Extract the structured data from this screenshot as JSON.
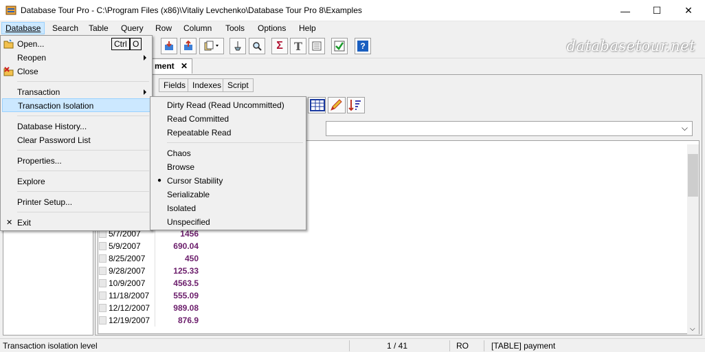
{
  "window": {
    "title": "Database Tour Pro - C:\\Program Files (x86)\\Vitaliy Levchenko\\Database Tour Pro 8\\Examples",
    "minimize": "—",
    "maximize": "☐",
    "close": "✕"
  },
  "menubar": [
    {
      "label": "Database"
    },
    {
      "label": "Search"
    },
    {
      "label": "Table"
    },
    {
      "label": "Query"
    },
    {
      "label": "Row"
    },
    {
      "label": "Column"
    },
    {
      "label": "Tools"
    },
    {
      "label": "Options"
    },
    {
      "label": "Help"
    }
  ],
  "watermark": "databasetour.net",
  "doc_tab": {
    "label": "ment",
    "close": "✕"
  },
  "subtabs": [
    "Fields",
    "Indexes",
    "Script"
  ],
  "database_menu": {
    "items": [
      {
        "label": "Open...",
        "shortcut_ctrl": "Ctrl",
        "shortcut_key": "O"
      },
      {
        "label": "Reopen"
      },
      {
        "label": "Close"
      },
      {
        "label": "Transaction"
      },
      {
        "label": "Transaction Isolation"
      },
      {
        "label": "Database History..."
      },
      {
        "label": "Clear Password List"
      },
      {
        "label": "Properties..."
      },
      {
        "label": "Explore"
      },
      {
        "label": "Printer Setup..."
      },
      {
        "label": "Exit"
      }
    ]
  },
  "isolation_menu": {
    "items": [
      {
        "label": "Dirty Read (Read Uncommitted)"
      },
      {
        "label": "Read Committed"
      },
      {
        "label": "Repeatable Read"
      },
      {
        "label": "Chaos"
      },
      {
        "label": "Browse"
      },
      {
        "label": "Cursor Stability",
        "checked": true
      },
      {
        "label": "Serializable"
      },
      {
        "label": "Isolated"
      },
      {
        "label": "Unspecified"
      }
    ]
  },
  "grid": {
    "rows": [
      {
        "date": "5/7/2007",
        "amount": "1456"
      },
      {
        "date": "5/9/2007",
        "amount": "690.04"
      },
      {
        "date": "8/25/2007",
        "amount": "450"
      },
      {
        "date": "9/28/2007",
        "amount": "125.33"
      },
      {
        "date": "10/9/2007",
        "amount": "4563.5"
      },
      {
        "date": "11/18/2007",
        "amount": "555.09"
      },
      {
        "date": "12/12/2007",
        "amount": "989.08"
      },
      {
        "date": "12/19/2007",
        "amount": "876.9"
      }
    ]
  },
  "statusbar": {
    "hint": "Transaction isolation level",
    "position": "1 / 41",
    "mode": "RO",
    "object": "[TABLE] payment"
  },
  "colors": {
    "amount": "#6b1d6b",
    "menu_highlight": "#cce8ff"
  }
}
